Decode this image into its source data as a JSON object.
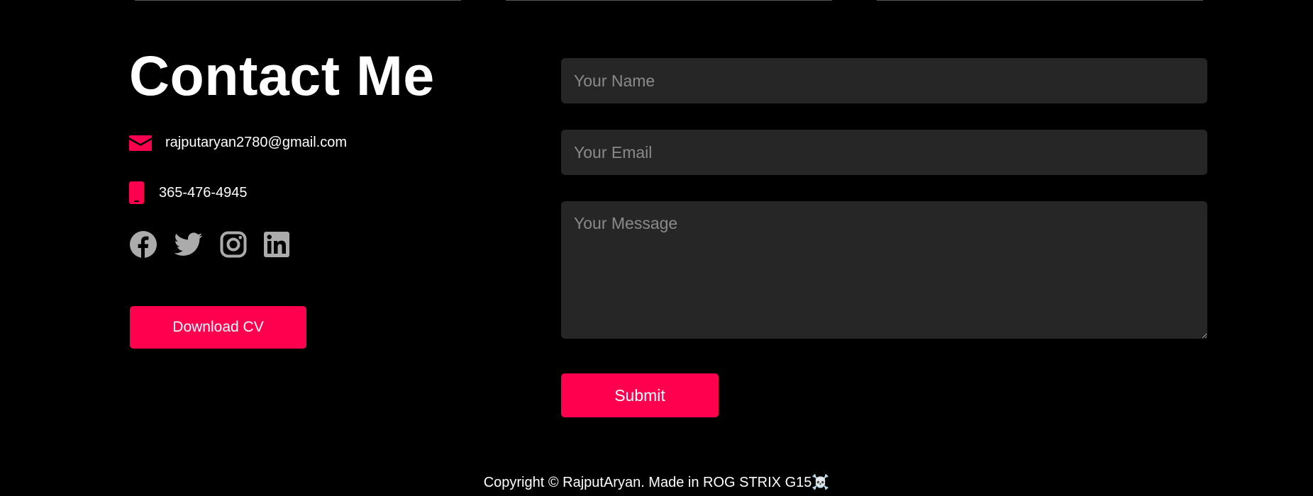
{
  "contact": {
    "title": "Contact Me",
    "email": "rajputaryan2780@gmail.com",
    "phone": "365-476-4945",
    "download_label": "Download CV"
  },
  "socials": [
    {
      "name": "facebook-icon"
    },
    {
      "name": "twitter-icon"
    },
    {
      "name": "instagram-icon"
    },
    {
      "name": "linkedin-icon"
    }
  ],
  "form": {
    "name_placeholder": "Your Name",
    "email_placeholder": "Your Email",
    "message_placeholder": "Your Message",
    "submit_label": "Submit"
  },
  "footer": {
    "text": "Copyright © RajputAryan. Made in ROG STRIX G15☠️"
  },
  "colors": {
    "accent": "#ff004f",
    "background": "#000000",
    "field_background": "#262626",
    "social_icon": "#ababab"
  }
}
